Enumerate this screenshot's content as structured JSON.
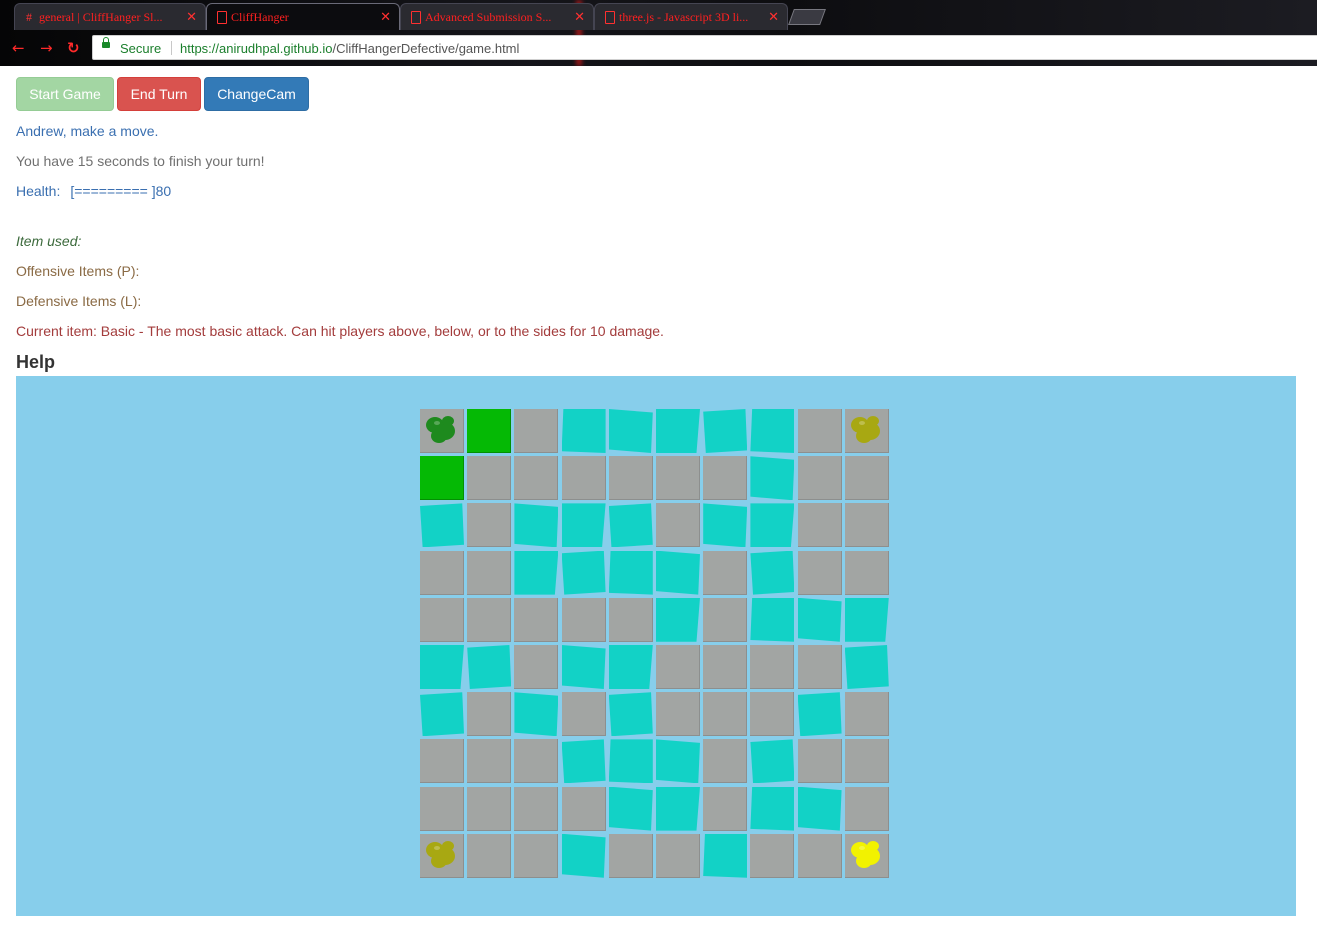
{
  "browser": {
    "tabs": [
      {
        "title": "general | CliffHanger Sl...",
        "icon": "hash-icon"
      },
      {
        "title": "CliffHanger",
        "icon": "document-icon",
        "active": true
      },
      {
        "title": "Advanced Submission S...",
        "icon": "document-icon"
      },
      {
        "title": "three.js - Javascript 3D li...",
        "icon": "document-icon"
      }
    ],
    "secure_label": "Secure",
    "url_scheme_host": "https://anirudhpal.github.io",
    "url_path": "/CliffHangerDefective/game.html"
  },
  "controls": {
    "start_label": "Start Game",
    "end_label": "End Turn",
    "cam_label": "ChangeCam"
  },
  "status": {
    "turn_text": "Andrew, make a move.",
    "time_text": "You have 15 seconds to finish your turn!",
    "health_label": "Health:",
    "health_bar": "[========= ]80",
    "health_value": 80,
    "item_used_label": "Item used:",
    "offensive_label": "Offensive Items (P):",
    "defensive_label": "Defensive Items (L):",
    "current_item_text": "Current item: Basic - The most basic attack. Can hit players above, below, or to the sides for 10 damage."
  },
  "help_heading": "Help",
  "board": {
    "size": 10,
    "legend": {
      "S": "stone",
      "W": "water",
      "G": "highlighted-move"
    },
    "rows": [
      "SGSWWWWWSS",
      "GSSSSSSWSS",
      "WSWWWSWWSS",
      "SSWWWWSWSS",
      "SSSSSWSWWW",
      "WWSWWSSSSW",
      "WSWSWSSSWS",
      "SSSWWWSWSS",
      "SSSSWWSWWS",
      "SSSWSSWSSS"
    ],
    "players": [
      {
        "name": "player-green",
        "row": 0,
        "col": 0,
        "color": "#1e8a1e"
      },
      {
        "name": "player-olive-top-right",
        "row": 0,
        "col": 9,
        "color": "#a8a812"
      },
      {
        "name": "player-olive-bottom-left",
        "row": 9,
        "col": 0,
        "color": "#a8a812"
      },
      {
        "name": "player-yellow",
        "row": 9,
        "col": 9,
        "color": "#f2f200"
      }
    ]
  }
}
